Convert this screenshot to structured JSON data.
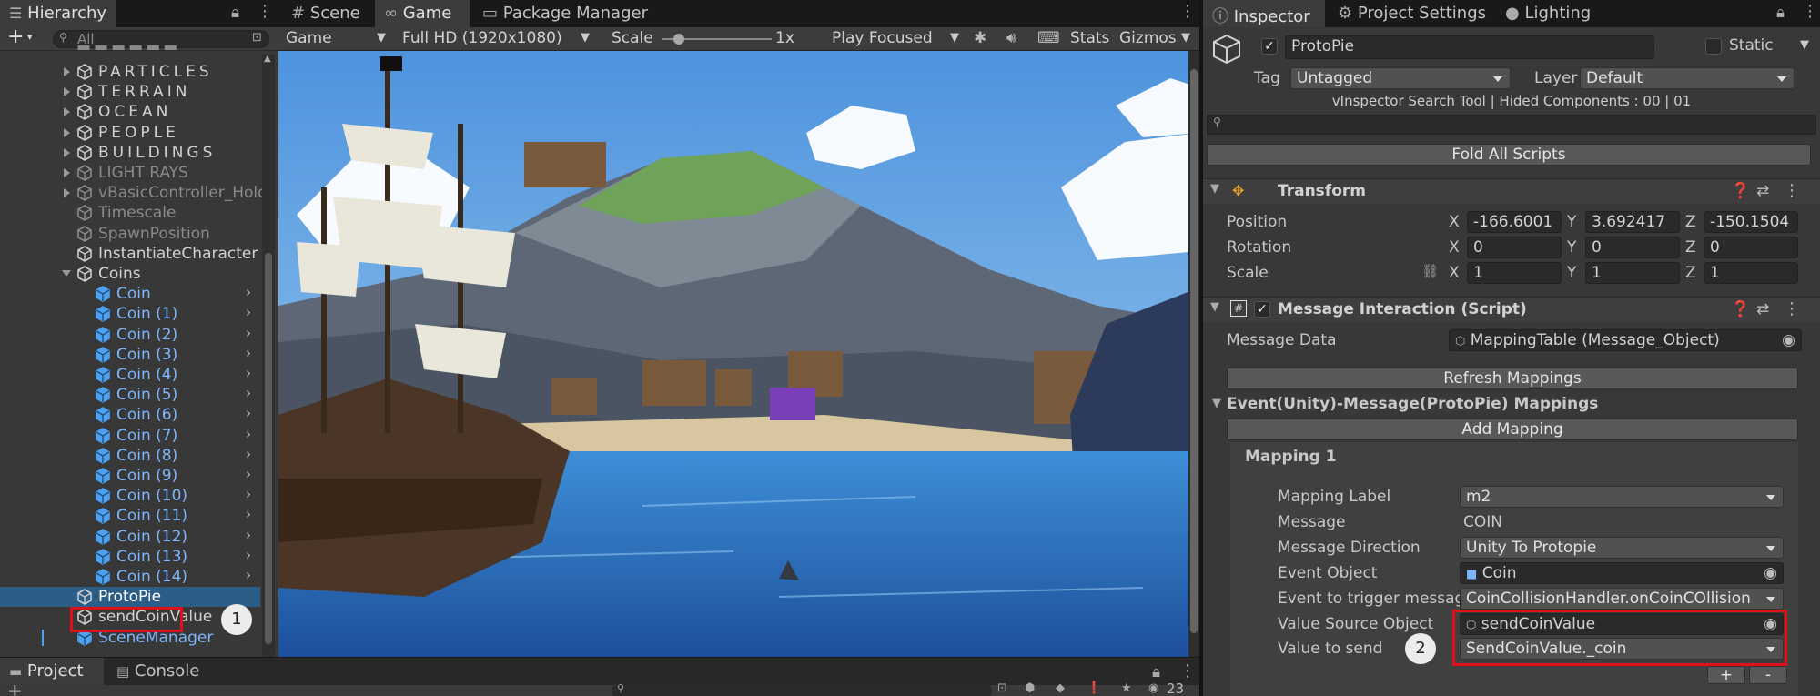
{
  "hierarchy": {
    "tab_label": "Hierarchy",
    "search_placeholder": "All",
    "items": [
      {
        "label": "PARTICLES",
        "kind": "group"
      },
      {
        "label": "TERRAIN",
        "kind": "group"
      },
      {
        "label": "OCEAN",
        "kind": "group"
      },
      {
        "label": "PEOPLE",
        "kind": "group"
      },
      {
        "label": "BUILDINGS",
        "kind": "group"
      },
      {
        "label": "LIGHT RAYS",
        "kind": "dim"
      },
      {
        "label": "vBasicController_Holdi",
        "kind": "dim"
      },
      {
        "label": "Timescale",
        "kind": "dim"
      },
      {
        "label": "SpawnPosition",
        "kind": "dim"
      },
      {
        "label": "InstantiateCharacter",
        "kind": "normal"
      },
      {
        "label": "Coins",
        "kind": "normal"
      }
    ],
    "coins": [
      "Coin",
      "Coin (1)",
      "Coin (2)",
      "Coin (3)",
      "Coin (4)",
      "Coin (5)",
      "Coin (6)",
      "Coin (7)",
      "Coin (8)",
      "Coin (9)",
      "Coin (10)",
      "Coin (11)",
      "Coin (12)",
      "Coin (13)",
      "Coin (14)"
    ],
    "protopie": "ProtoPie",
    "send_coin_value": "sendCoinValue",
    "scene_manager": "SceneManager",
    "badge_1": "1"
  },
  "bottom": {
    "project_tab": "Project",
    "console_tab": "Console",
    "count": "23"
  },
  "center": {
    "tabs": [
      "Scene",
      "Game",
      "Package Manager"
    ],
    "display": "Game",
    "resolution": "Full HD (1920x1080)",
    "scale_label": "Scale",
    "scale_value": "1x",
    "play_mode": "Play Focused",
    "stats": "Stats",
    "gizmos": "Gizmos"
  },
  "inspector": {
    "tabs": [
      "Inspector",
      "Project Settings",
      "Lighting"
    ],
    "object_name": "ProtoPie",
    "static_label": "Static",
    "tag_label": "Tag",
    "tag_value": "Untagged",
    "layer_label": "Layer",
    "layer_value": "Default",
    "search_tool_text": "vInspector Search Tool | Hided Components : 00 | 01",
    "fold_all": "Fold All Scripts",
    "transform": {
      "title": "Transform",
      "position_label": "Position",
      "rotation_label": "Rotation",
      "scale_label": "Scale",
      "pos": [
        "-166.6001",
        "3.692417",
        "-150.1504"
      ],
      "rot": [
        "0",
        "0",
        "0"
      ],
      "scl": [
        "1",
        "1",
        "1"
      ],
      "axes": [
        "X",
        "Y",
        "Z"
      ]
    },
    "script": {
      "title": "Message Interaction (Script)",
      "message_data_label": "Message Data",
      "message_data_value": "MappingTable (Message_Object)",
      "refresh": "Refresh Mappings",
      "mappings_title": "Event(Unity)-Message(ProtoPie) Mappings",
      "add_mapping": "Add Mapping",
      "mapping_title": "Mapping 1",
      "mapping_label_label": "Mapping Label",
      "mapping_label_value": "m2",
      "message_label": "Message",
      "message_value": "COIN",
      "direction_label": "Message Direction",
      "direction_value": "Unity To Protopie",
      "event_object_label": "Event Object",
      "event_object_value": "Coin",
      "event_trigger_label": "Event to trigger message",
      "event_trigger_value": "CoinCollisionHandler.onCoinCOllision",
      "value_source_label": "Value Source Object",
      "value_source_value": "sendCoinValue",
      "value_send_label": "Value to send",
      "value_send_value": "SendCoinValue._coin",
      "plus": "+",
      "minus": "-",
      "badge_2": "2"
    }
  },
  "colors": {
    "selection": "#2c5d87",
    "highlight_red": "#e0101a",
    "prefab_blue": "#7cb6ff"
  }
}
